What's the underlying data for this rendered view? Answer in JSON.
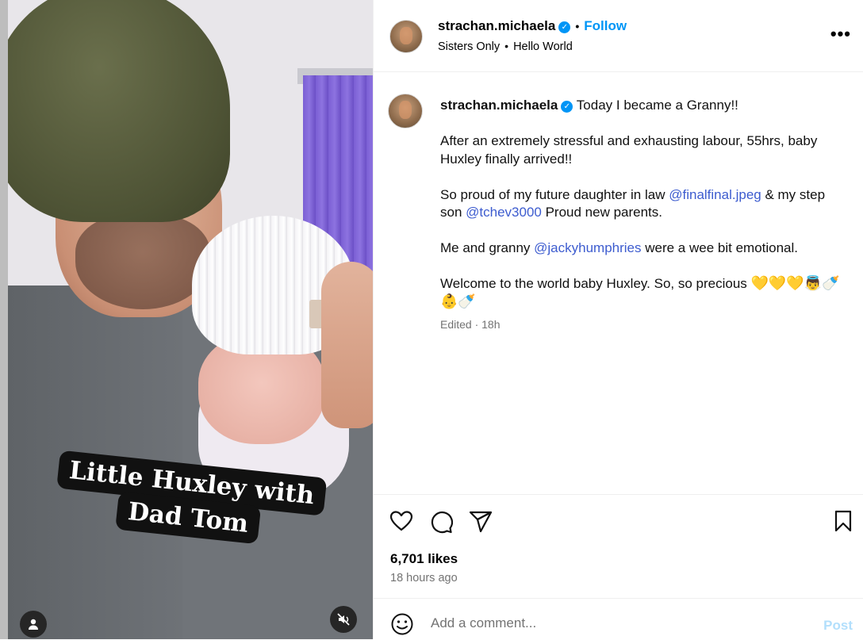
{
  "media": {
    "caption_line1": "Little Huxley with",
    "caption_line2": "Dad Tom"
  },
  "header": {
    "username": "strachan.michaela",
    "follow_label": "Follow",
    "subtitle_left": "Sisters Only",
    "subtitle_right": "Hello World"
  },
  "post": {
    "username": "strachan.michaela",
    "first_line": "Today I became a Granny!!",
    "para2": "After an extremely stressful and exhausting labour, 55hrs, baby Huxley finally arrived!!",
    "para3_a": "So proud of my future daughter in law ",
    "para3_mention1": "@finalfinal.jpeg",
    "para3_b": " & my step son ",
    "para3_mention2": "@tchev3000",
    "para3_c": " Proud new parents.",
    "para4_a": "Me and granny ",
    "para4_mention": "@jackyhumphries",
    "para4_b": " were a wee bit emotional.",
    "para5": "Welcome to the world baby Huxley. So, so precious ",
    "para5_emojis": "💛💛💛👼🍼👶🍼",
    "edited": "Edited · 18h"
  },
  "engagement": {
    "likes": "6,701 likes",
    "time": "18 hours ago"
  },
  "comment": {
    "placeholder": "Add a comment...",
    "post_label": "Post"
  }
}
